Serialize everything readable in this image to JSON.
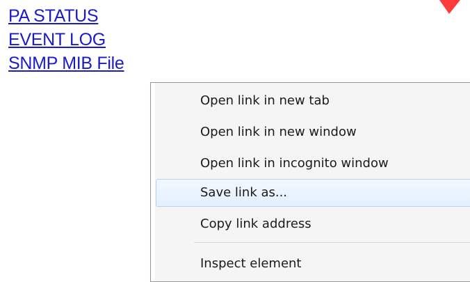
{
  "links": [
    {
      "label": "PA STATUS"
    },
    {
      "label": "EVENT LOG"
    },
    {
      "label": "SNMP MIB File"
    }
  ],
  "context_menu": {
    "items": [
      {
        "label": "Open link in new tab"
      },
      {
        "label": "Open link in new window"
      },
      {
        "label": "Open link in incognito window"
      },
      {
        "label": "Save link as..."
      },
      {
        "label": "Copy link address"
      },
      {
        "label": "Inspect element"
      }
    ],
    "highlighted_item": "Save link as..."
  },
  "colors": {
    "link": "#1a1acc",
    "menu_background": "#f5f5f5",
    "menu_highlight_border": "#b9d2f2",
    "corner_mark": "#ff3b3b"
  }
}
